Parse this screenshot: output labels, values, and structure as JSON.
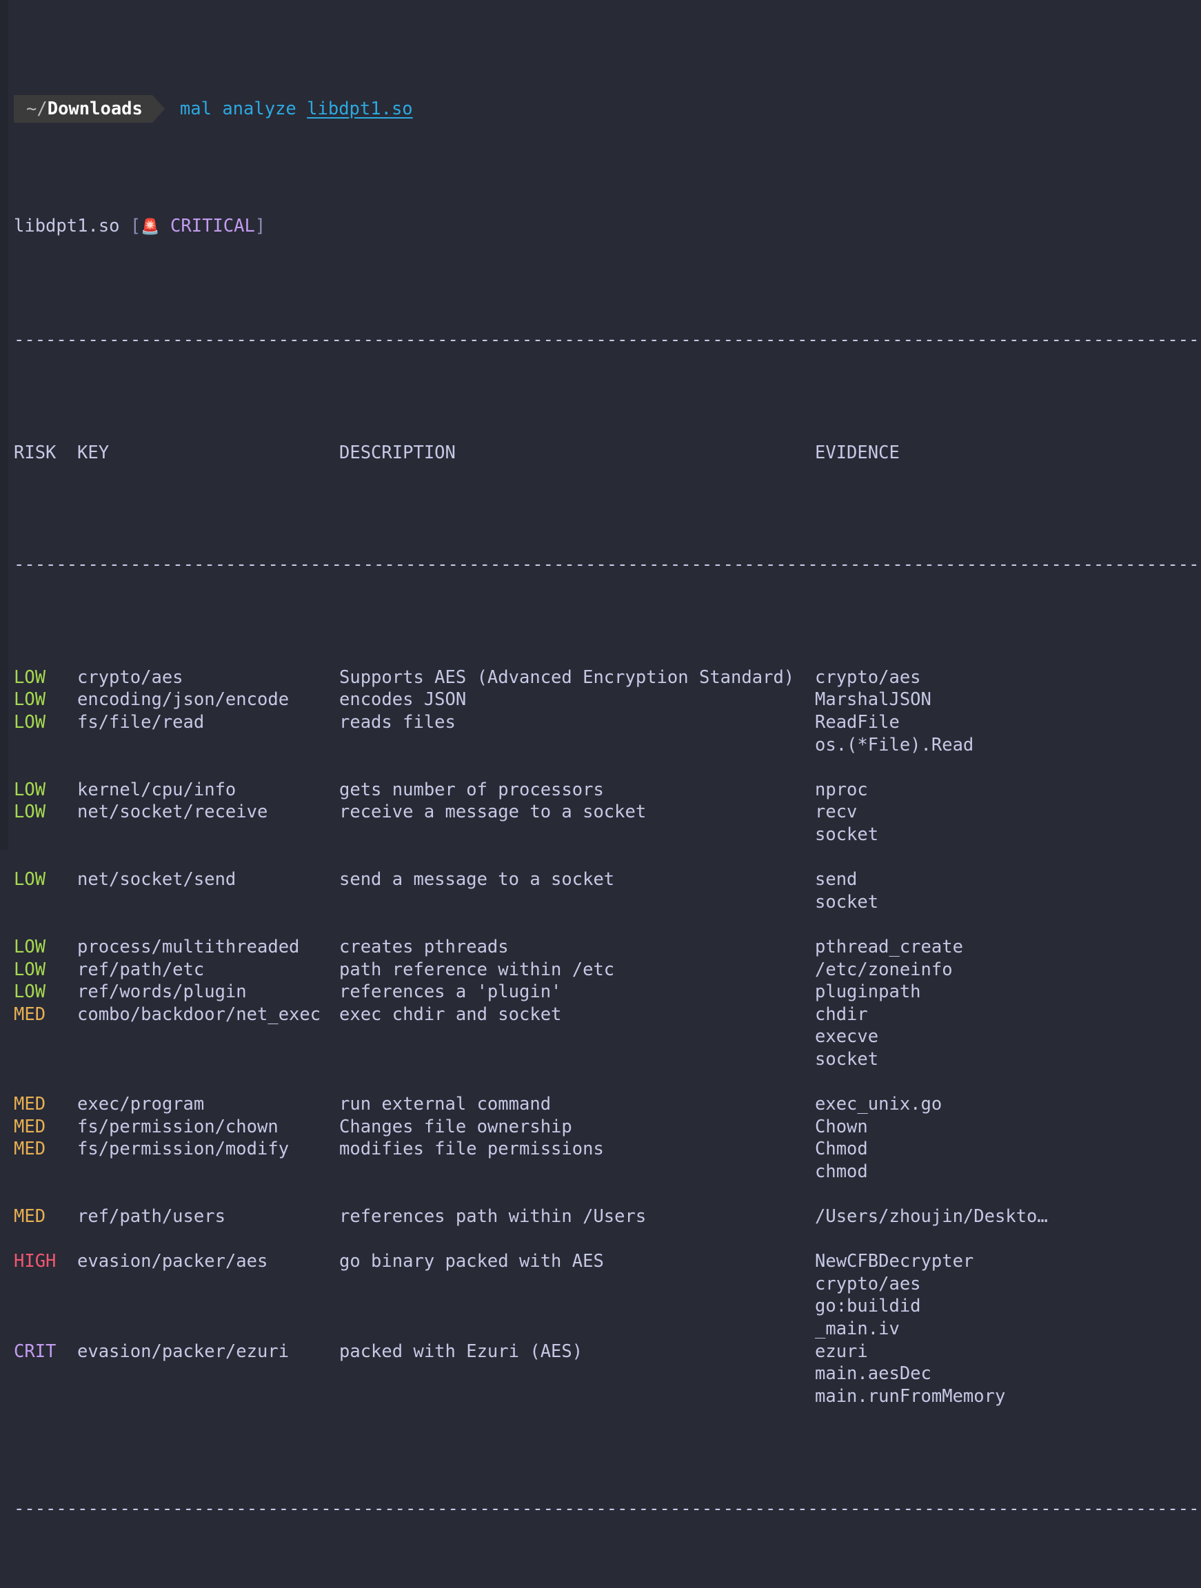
{
  "terminal": {
    "background": "#282a36",
    "foreground": "#c6c9e4"
  },
  "prompt": {
    "tilde": "~",
    "slash": "/",
    "dir": "Downloads",
    "command": "mal",
    "subcommand": "analyze",
    "argument": "libdpt1.so",
    "command_line": "mal analyze libdpt1.so"
  },
  "result_header": {
    "filename": "libdpt1.so",
    "open_bracket": "[",
    "siren_icon": "🚨",
    "verdict": "CRITICAL",
    "close_bracket": "]",
    "verdict_color": "#c39cf0"
  },
  "separator": "--------------------------------------------------------------------------------------------------------------------------------------------------------------",
  "table": {
    "columns": [
      "RISK",
      "KEY",
      "DESCRIPTION",
      "EVIDENCE"
    ],
    "risk_colors": {
      "LOW": "#a6d94f",
      "MED": "#e8b052",
      "HIGH": "#f2576f",
      "CRIT": "#c39cf0"
    },
    "rows": [
      {
        "risk": "LOW",
        "key": "crypto/aes",
        "desc": "Supports AES (Advanced Encryption Standard)",
        "evidence": [
          "crypto/aes"
        ]
      },
      {
        "risk": "LOW",
        "key": "encoding/json/encode",
        "desc": "encodes JSON",
        "evidence": [
          "MarshalJSON"
        ]
      },
      {
        "risk": "LOW",
        "key": "fs/file/read",
        "desc": "reads files",
        "evidence": [
          "ReadFile",
          "os.(*File).Read"
        ]
      },
      {
        "risk": "LOW",
        "key": "kernel/cpu/info",
        "desc": "gets number of processors",
        "evidence": [
          "nproc"
        ]
      },
      {
        "risk": "LOW",
        "key": "net/socket/receive",
        "desc": "receive a message to a socket",
        "evidence": [
          "recv",
          "socket"
        ]
      },
      {
        "risk": "LOW",
        "key": "net/socket/send",
        "desc": "send a message to a socket",
        "evidence": [
          "send",
          "socket"
        ]
      },
      {
        "risk": "LOW",
        "key": "process/multithreaded",
        "desc": "creates pthreads",
        "evidence": [
          "pthread_create"
        ]
      },
      {
        "risk": "LOW",
        "key": "ref/path/etc",
        "desc": "path reference within /etc",
        "evidence": [
          "/etc/zoneinfo"
        ]
      },
      {
        "risk": "LOW",
        "key": "ref/words/plugin",
        "desc": "references a 'plugin'",
        "evidence": [
          "pluginpath"
        ]
      },
      {
        "risk": "MED",
        "key": "combo/backdoor/net_exec",
        "desc": "exec chdir and socket",
        "evidence": [
          "chdir",
          "execve",
          "socket"
        ]
      },
      {
        "risk": "MED",
        "key": "exec/program",
        "desc": "run external command",
        "evidence": [
          "exec_unix.go"
        ]
      },
      {
        "risk": "MED",
        "key": "fs/permission/chown",
        "desc": "Changes file ownership",
        "evidence": [
          "Chown"
        ]
      },
      {
        "risk": "MED",
        "key": "fs/permission/modify",
        "desc": "modifies file permissions",
        "evidence": [
          "Chmod",
          "chmod"
        ]
      },
      {
        "risk": "MED",
        "key": "ref/path/users",
        "desc": "references path within /Users",
        "evidence": [
          "/Users/zhoujin/Deskto…"
        ]
      },
      {
        "risk": "HIGH",
        "key": "evasion/packer/aes",
        "desc": "go binary packed with AES",
        "evidence": [
          "NewCFBDecrypter",
          "crypto/aes",
          "go:buildid",
          "_main.iv"
        ]
      },
      {
        "risk": "CRIT",
        "key": "evasion/packer/ezuri",
        "desc": "packed with Ezuri (AES)",
        "evidence": [
          "ezuri",
          "main.aesDec",
          "main.runFromMemory"
        ]
      }
    ]
  }
}
